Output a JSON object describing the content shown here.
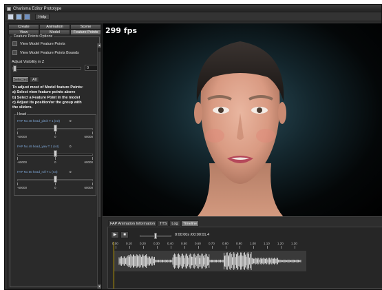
{
  "window": {
    "title": "Charisma Editor Prototype"
  },
  "menu": {
    "help": "Help"
  },
  "toolbar": {
    "new_icon": "new-file-icon",
    "open_icon": "open-folder-icon",
    "save_icon": "save-icon"
  },
  "left_panel": {
    "tabs_row1": [
      "Create",
      "Animation",
      "Scene"
    ],
    "tabs_row2": [
      "View",
      "Model",
      "Feature Points"
    ],
    "options_title": "Feature Points Options",
    "checkbox_feature_points": "View Model Feature Points",
    "checkbox_feature_bounds": "View Model Feature Points Bounds",
    "adjust_label": "Adjust Visibility in Z",
    "adjust_value": "0",
    "selected_btn": "Selected",
    "all_btn": "All",
    "instructions": [
      "To adjust most of Model feature Points:",
      "a) Select view feature points above",
      "b) Select a Feature Point in the model",
      "c) Adjust its position/or the group with",
      "    the sliders."
    ],
    "head_group_title": "Head",
    "faps": [
      {
        "label": "FAP No 48 head_pitch T 1 (rot)",
        "value": "0",
        "min": "-60000",
        "mid": "0",
        "max": "60000",
        "position": 0.5
      },
      {
        "label": "FAP No 49 head_yaw T 1 (rot)",
        "value": "0",
        "min": "-60000",
        "mid": "0",
        "max": "60000",
        "position": 0.5
      },
      {
        "label": "FAP No 50 head_roll T 1 (rot)",
        "value": "0",
        "min": "-60000",
        "mid": "0",
        "max": "60000",
        "position": 0.5
      }
    ]
  },
  "viewport": {
    "fps": "299 fps"
  },
  "bottom_panel": {
    "tabs": [
      "FAP Animation Information",
      "TTS",
      "Log",
      "Timeline"
    ],
    "active_tab": "Timeline",
    "time_display": "0:00:00s /00:00:01.4",
    "ruler": [
      "0.00",
      "0.10",
      "0.20",
      "0.30",
      "0.40",
      "0.50",
      "0.60",
      "0.70",
      "0.80",
      "0.90",
      "1.00",
      "1.10",
      "1.20",
      "1.30"
    ]
  },
  "colors": {
    "background": "#2d2d2d",
    "fap_label": "#7fa8d8",
    "cursor": "#c8a400"
  }
}
